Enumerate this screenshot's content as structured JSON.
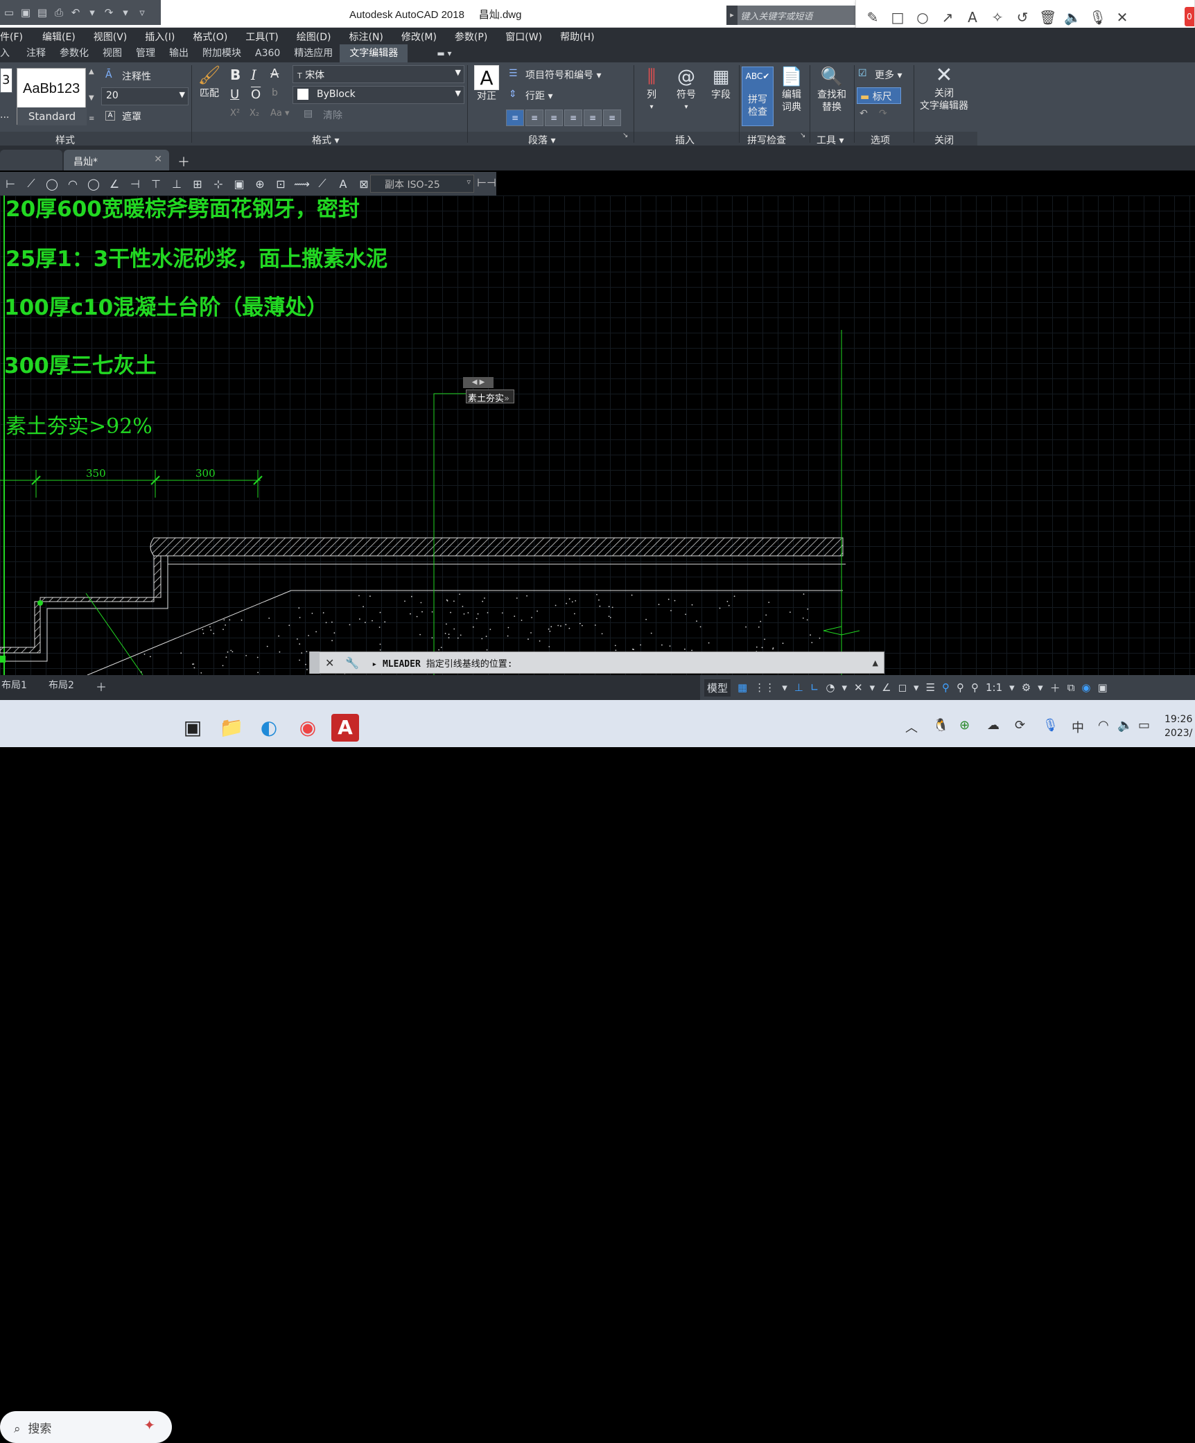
{
  "window": {
    "title": "Autodesk AutoCAD 2018",
    "filename": "昌灿.dwg",
    "search_placeholder": "键入关键字或短语"
  },
  "annotation_toolbar": {
    "badge": "0"
  },
  "menu": [
    "件(F)",
    "编辑(E)",
    "视图(V)",
    "插入(I)",
    "格式(O)",
    "工具(T)",
    "绘图(D)",
    "标注(N)",
    "修改(M)",
    "参数(P)",
    "窗口(W)",
    "帮助(H)"
  ],
  "ribbon_tabs": [
    "入",
    "注释",
    "参数化",
    "视图",
    "管理",
    "输出",
    "附加模块",
    "A360",
    "精选应用",
    "文字编辑器"
  ],
  "ribbon": {
    "style": {
      "partial": "3",
      "preview": "AaBb123",
      "name": "Standard",
      "label": "样式",
      "annotative": "注释性",
      "height": "20",
      "mask": "遮罩",
      "ellipsis": "..."
    },
    "format": {
      "match": "匹配",
      "font": "宋体",
      "color": "ByBlock",
      "clear": "清除",
      "label": "格式"
    },
    "paragraph": {
      "justify": "对正",
      "bullets": "项目符号和编号",
      "line_spacing": "行距",
      "label": "段落"
    },
    "insert": {
      "columns": "列",
      "symbol": "符号",
      "field": "字段",
      "label": "插入"
    },
    "spell": {
      "check_line1": "拼写",
      "check_line2": "检查",
      "dict_line1": "编辑",
      "dict_line2": "词典",
      "label": "拼写检查"
    },
    "tools": {
      "find_line1": "查找和",
      "find_line2": "替换",
      "label": "工具"
    },
    "options": {
      "more": "更多",
      "ruler": "标尺",
      "label": "选项"
    },
    "close": {
      "line1": "关闭",
      "line2": "文字编辑器",
      "label": "关闭"
    }
  },
  "doc_tab": {
    "name": "昌灿*"
  },
  "dim_style": "副本 ISO-25",
  "drawing": {
    "lines": [
      "20厚600宽暖棕斧劈面花钢牙，密封",
      "25厚1：3干性水泥砂浆，面上撒素水泥",
      "100厚c10混凝土台阶（最薄处）",
      "300厚三七灰土",
      "素土夯实>92%"
    ],
    "dims": [
      "350",
      "300"
    ],
    "leader_text": "素土夯实"
  },
  "command": {
    "name": "MLEADER",
    "prompt": "指定引线基线的位置:"
  },
  "layouts": [
    "布局1",
    "布局2"
  ],
  "status": {
    "model": "模型",
    "scale": "1:1"
  },
  "taskbar": {
    "search": "搜索",
    "time": "19:26",
    "date": "2023/",
    "ime": "中"
  }
}
